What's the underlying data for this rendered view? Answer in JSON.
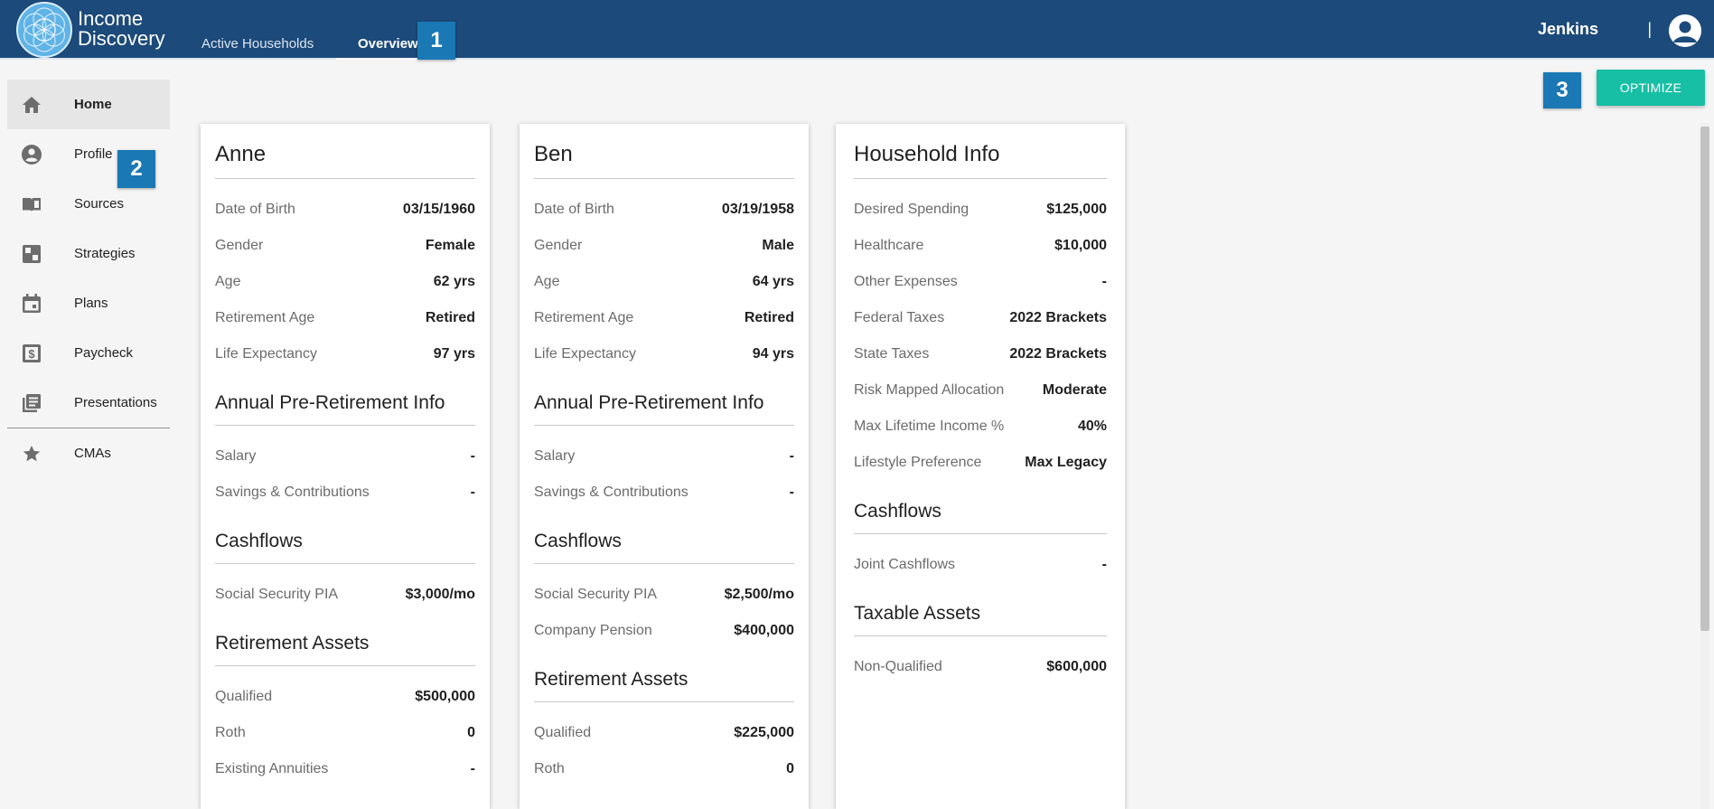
{
  "app": {
    "brand_line1": "Income",
    "brand_line2": "Discovery",
    "tabs": [
      {
        "label": "Active Households",
        "active": false
      },
      {
        "label": "Overview",
        "active": true
      }
    ],
    "user_name": "Jenkins",
    "separator": "|"
  },
  "badges": [
    "1",
    "2",
    "3"
  ],
  "sidebar": {
    "items": [
      {
        "label": "Home",
        "icon": "home-icon",
        "active": true
      },
      {
        "label": "Profile",
        "icon": "account-circle-icon"
      },
      {
        "label": "Sources",
        "icon": "book-icon"
      },
      {
        "label": "Strategies",
        "icon": "strategy-icon"
      },
      {
        "label": "Plans",
        "icon": "calendar-icon"
      },
      {
        "label": "Paycheck",
        "icon": "dollar-icon"
      },
      {
        "label": "Presentations",
        "icon": "library-icon"
      },
      {
        "label": "CMAs",
        "icon": "star-icon"
      }
    ]
  },
  "optimize_label": "OPTIMIZE",
  "colors": {
    "topbar": "#1c4a7a",
    "badge": "#1a78b4",
    "optimize": "#17bfa4"
  },
  "cards": {
    "anne": {
      "title": "Anne",
      "info": [
        {
          "label": "Date of Birth",
          "value": "03/15/1960"
        },
        {
          "label": "Gender",
          "value": "Female"
        },
        {
          "label": "Age",
          "value": "62 yrs"
        },
        {
          "label": "Retirement Age",
          "value": "Retired"
        },
        {
          "label": "Life Expectancy",
          "value": "97 yrs"
        }
      ],
      "pre_retirement_title": "Annual Pre-Retirement Info",
      "pre_retirement": [
        {
          "label": "Salary",
          "value": "-"
        },
        {
          "label": "Savings & Contributions",
          "value": "-"
        }
      ],
      "cashflows_title": "Cashflows",
      "cashflows": [
        {
          "label": "Social Security PIA",
          "value": "$3,000/mo"
        }
      ],
      "assets_title": "Retirement Assets",
      "assets": [
        {
          "label": "Qualified",
          "value": "$500,000"
        },
        {
          "label": "Roth",
          "value": "0"
        },
        {
          "label": "Existing Annuities",
          "value": "-"
        }
      ]
    },
    "ben": {
      "title": "Ben",
      "info": [
        {
          "label": "Date of Birth",
          "value": "03/19/1958"
        },
        {
          "label": "Gender",
          "value": "Male"
        },
        {
          "label": "Age",
          "value": "64 yrs"
        },
        {
          "label": "Retirement Age",
          "value": "Retired"
        },
        {
          "label": "Life Expectancy",
          "value": "94 yrs"
        }
      ],
      "pre_retirement_title": "Annual Pre-Retirement Info",
      "pre_retirement": [
        {
          "label": "Salary",
          "value": "-"
        },
        {
          "label": "Savings & Contributions",
          "value": "-"
        }
      ],
      "cashflows_title": "Cashflows",
      "cashflows": [
        {
          "label": "Social Security PIA",
          "value": "$2,500/mo"
        },
        {
          "label": "Company Pension",
          "value": "$400,000"
        }
      ],
      "assets_title": "Retirement Assets",
      "assets": [
        {
          "label": "Qualified",
          "value": "$225,000"
        },
        {
          "label": "Roth",
          "value": "0"
        }
      ]
    },
    "household": {
      "title": "Household Info",
      "info": [
        {
          "label": "Desired Spending",
          "value": "$125,000"
        },
        {
          "label": "Healthcare",
          "value": "$10,000"
        },
        {
          "label": "Other Expenses",
          "value": "-"
        },
        {
          "label": "Federal Taxes",
          "value": "2022 Brackets"
        },
        {
          "label": "State Taxes",
          "value": "2022 Brackets"
        },
        {
          "label": "Risk Mapped Allocation",
          "value": "Moderate"
        },
        {
          "label": "Max Lifetime Income %",
          "value": "40%"
        },
        {
          "label": "Lifestyle Preference",
          "value": "Max Legacy"
        }
      ],
      "cashflows_title": "Cashflows",
      "cashflows": [
        {
          "label": "Joint Cashflows",
          "value": "-"
        }
      ],
      "taxable_title": "Taxable Assets",
      "taxable": [
        {
          "label": "Non-Qualified",
          "value": "$600,000"
        }
      ]
    }
  }
}
